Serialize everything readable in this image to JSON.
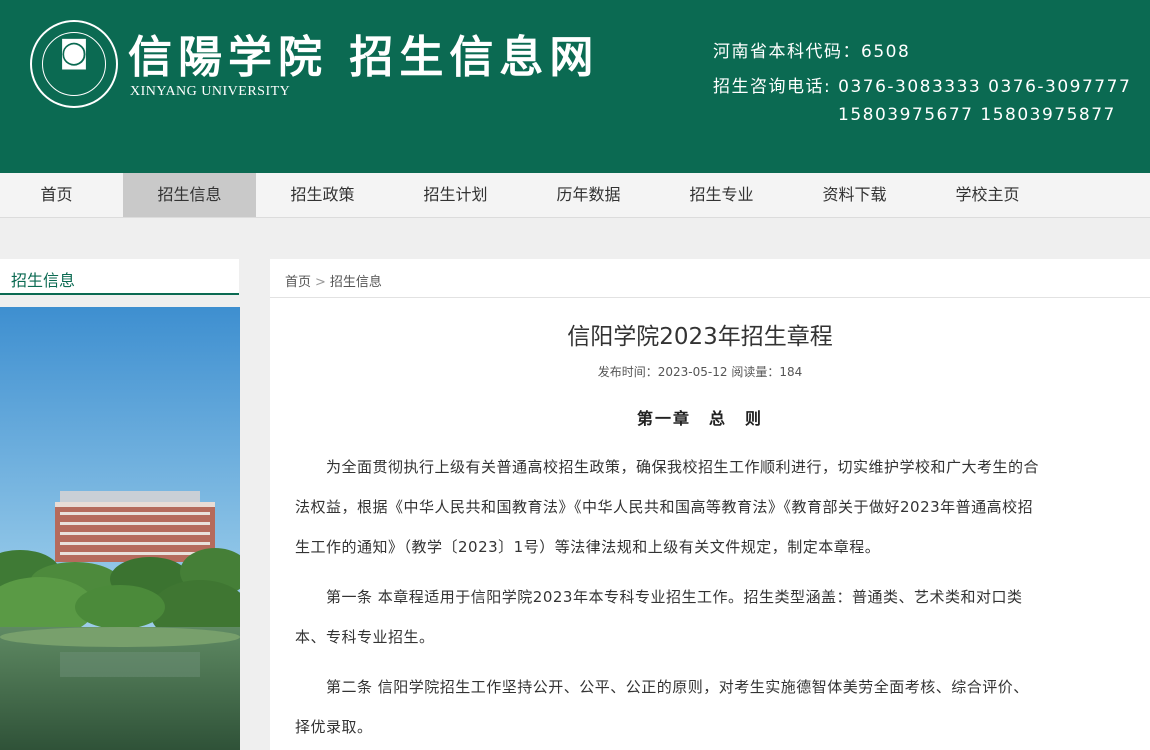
{
  "header": {
    "logo_cn": "信陽学院 招生信息网",
    "logo_en": "XINYANG UNIVERSITY",
    "contact_lines": [
      "河南省本科代码：6508",
      "招生咨询电话: 0376-3083333 0376-3097777",
      "15803975677 15803975877"
    ],
    "brand_color": "#0b6a52"
  },
  "nav": {
    "items": [
      "首页",
      "招生信息",
      "招生政策",
      "招生计划",
      "历年数据",
      "招生专业",
      "资料下载",
      "学校主页"
    ],
    "active": "招生信息"
  },
  "sidebar": {
    "title": "招生信息"
  },
  "breadcrumb": {
    "home": "首页",
    "sep": ">",
    "current": "招生信息"
  },
  "article": {
    "title": "信阳学院2023年招生章程",
    "meta": "发布时间：2023-05-12 阅读量：184",
    "chapter": "第一章　总　则",
    "lines": [
      "　　为全面贯彻执行上级有关普通高校招生政策，确保我校招生工作顺利进行，切实维护学校和广大考生的合",
      "法权益，根据《中华人民共和国教育法》《中华人民共和国高等教育法》《教育部关于做好2023年普通高校招",
      "生工作的通知》（教学〔2023〕1号）等法律法规和上级有关文件规定，制定本章程。",
      "　　第一条 本章程适用于信阳学院2023年本专科专业招生工作。招生类型涵盖：普通类、艺术类和对口类",
      "本、专科专业招生。",
      "　　第二条 信阳学院招生工作坚持公开、公平、公正的原则，对考生实施德智体美劳全面考核、综合评价、",
      "择优录取。"
    ]
  }
}
